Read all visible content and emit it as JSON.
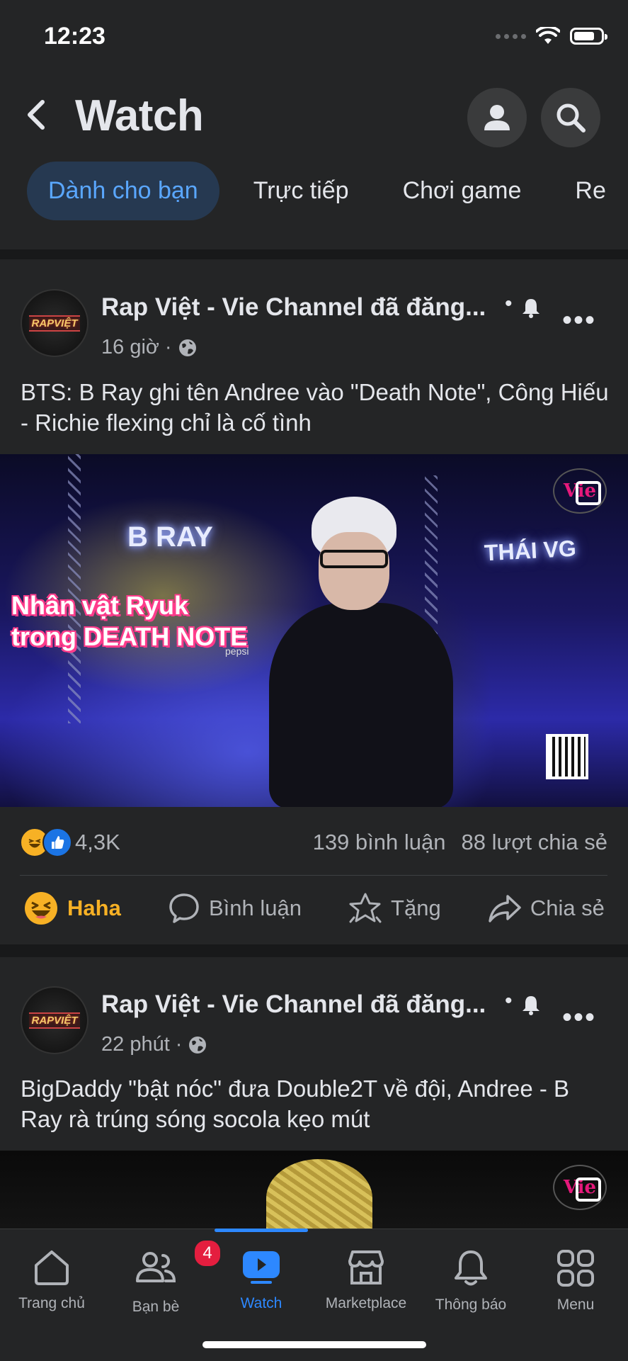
{
  "status_bar": {
    "time": "12:23"
  },
  "header": {
    "title": "Watch"
  },
  "tabs": [
    {
      "label": "Dành cho bạn",
      "active": true
    },
    {
      "label": "Trực tiếp"
    },
    {
      "label": "Chơi game"
    },
    {
      "label": "Re"
    }
  ],
  "posts": [
    {
      "avatar_text": "RAPVIỆT",
      "page_name": "Rap Việt - Vie Channel đã đăng...",
      "time": "16 giờ",
      "text": "BTS: B Ray ghi tên Andree vào \"Death Note\", Công Hiếu - Richie flexing chỉ là cố tình",
      "video": {
        "overlay_line1": "Nhân vật Ryuk",
        "overlay_line2": "trong DEATH NOTE",
        "sign_left": "B RAY",
        "sign_right": "THÁI VG",
        "cup_text": "pepsi",
        "logo": "Vie"
      },
      "reaction_count": "4,3K",
      "comments": "139 bình luận",
      "shares": "88 lượt chia sẻ",
      "actions": {
        "react": "Haha",
        "comment": "Bình luận",
        "gift": "Tặng",
        "share": "Chia sẻ"
      }
    },
    {
      "avatar_text": "RAPVIỆT",
      "page_name": "Rap Việt - Vie Channel đã đăng...",
      "time": "22 phút",
      "text": "BigDaddy \"bật nóc\" đưa Double2T về đội, Andree - B Ray rà trúng sóng socola kẹo mút",
      "video": {
        "logo": "Vie"
      }
    }
  ],
  "bottom_nav": [
    {
      "label": "Trang chủ",
      "icon": "home-icon"
    },
    {
      "label": "Bạn bè",
      "icon": "friends-icon",
      "badge": "4"
    },
    {
      "label": "Watch",
      "icon": "watch-icon",
      "active": true
    },
    {
      "label": "Marketplace",
      "icon": "marketplace-icon"
    },
    {
      "label": "Thông báo",
      "icon": "bell-icon"
    },
    {
      "label": "Menu",
      "icon": "menu-grid-icon"
    }
  ],
  "colors": {
    "background": "#242526",
    "divider": "#18191a",
    "accent": "#2d88ff",
    "haha": "#f7b125",
    "badge": "#e41e3f"
  }
}
